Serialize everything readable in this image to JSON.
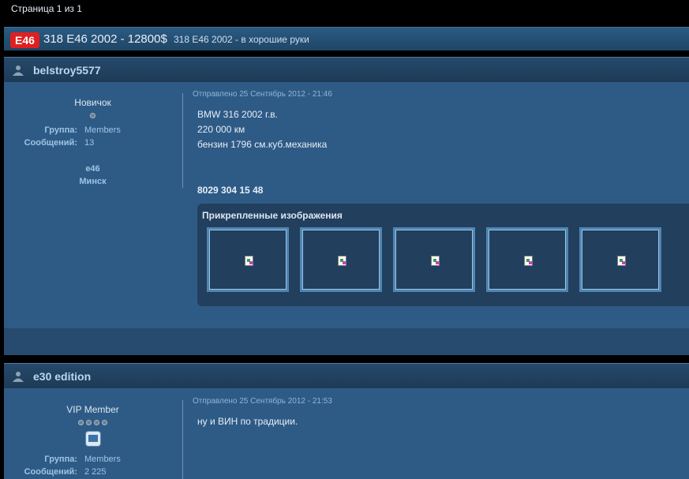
{
  "pager": {
    "label": "Страница 1 из 1"
  },
  "topic": {
    "prefix": "E46",
    "title": "318 E46 2002 - 12800$",
    "description": "318 E46 2002 - в хорошие руки",
    "prefix_color": "#e02020"
  },
  "posts": [
    {
      "username": "belstroy5577",
      "rank": "Новичок",
      "pips": 1,
      "group_label": "Группа:",
      "group_value": "Members",
      "posts_label": "Сообщений:",
      "posts_value": "13",
      "car": "e46",
      "city": "Минск",
      "date": "Отправлено 25 Сентябрь 2012 - 21:46",
      "lines": [
        "BMW 316 2002 г.в.",
        "220 000 км",
        "бензин 1796 см.куб.механика"
      ],
      "phone": "8029 304 15 48",
      "attachments_title": "Прикрепленные изображения",
      "attachments_count": 5
    },
    {
      "username": "e30 edition",
      "rank": "VIP Member",
      "pips": 4,
      "group_label": "Группа:",
      "group_value": "Members",
      "posts_label": "Сообщений:",
      "posts_value": "2 225",
      "date": "Отправлено 25 Сентябрь 2012 - 21:53",
      "lines": [
        "ну и ВИН по традиции."
      ]
    }
  ]
}
